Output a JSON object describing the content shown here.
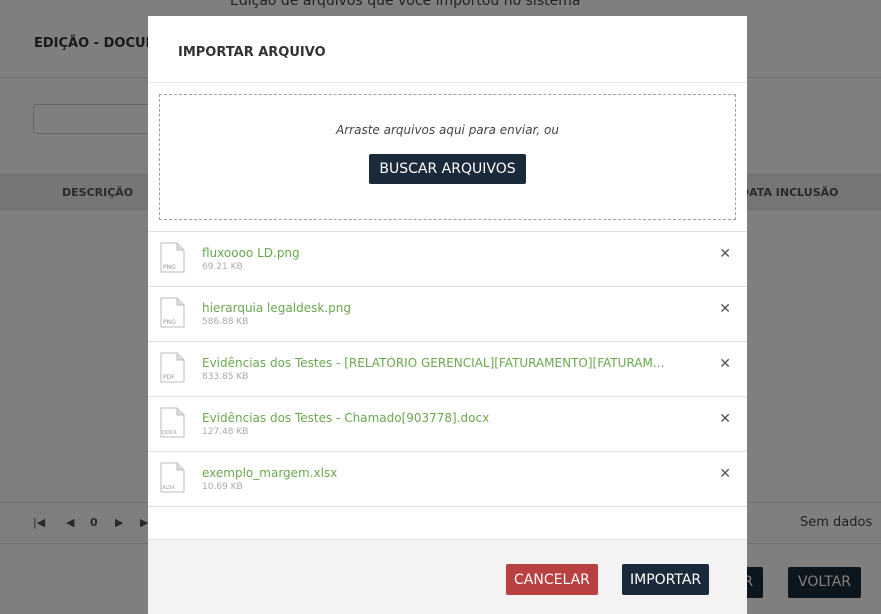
{
  "background": {
    "top_text": "Edição de arquivos que você importou no sistema",
    "page_title": "EDIÇÃO - DOCUMENTOS",
    "columns": [
      "DESCRIÇÃO",
      "DATA INCLUSÃO"
    ],
    "pager": {
      "first": "|◀",
      "prev": "◀",
      "page": "0",
      "next": "▶",
      "last": "▶|"
    },
    "no_data": "Sem dados",
    "save_label": "SALVAR",
    "back_label": "VOLTAR"
  },
  "modal": {
    "title": "IMPORTAR ARQUIVO",
    "dropzone_text": "Arraste arquivos aqui para enviar, ou",
    "browse_label": "BUSCAR ARQUIVOS",
    "files": [
      {
        "name": "fluxoooo LD.png",
        "size": "69.21 KB",
        "ext": "PNG"
      },
      {
        "name": "hierarquia legaldesk.png",
        "size": "586.88 KB",
        "ext": "PNG"
      },
      {
        "name": "Evidências dos Testes - [RELATÓRIO GERENCIAL][FATURAMENTO][FATURAM...",
        "size": "833.85 KB",
        "ext": "PDF"
      },
      {
        "name": "Evidências dos Testes - Chamado[903778].docx",
        "size": "127.48 KB",
        "ext": "DOCX"
      },
      {
        "name": "exemplo_margem.xlsx",
        "size": "10.69 KB",
        "ext": "XLSX"
      }
    ],
    "remove_glyph": "✕",
    "cancel_label": "CANCELAR",
    "import_label": "IMPORTAR"
  },
  "colors": {
    "primary": "#1b2a3a",
    "danger": "#b84040",
    "file_name": "#6aa84f"
  }
}
